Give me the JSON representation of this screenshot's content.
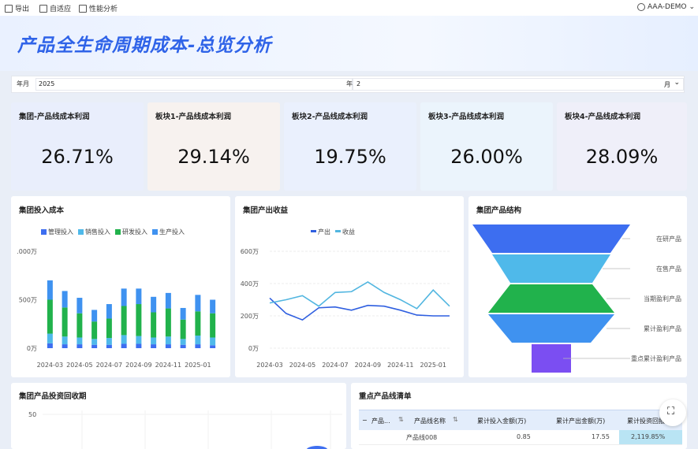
{
  "toolbar": {
    "export_label": "导出",
    "fit_label": "自适应",
    "perf_label": "性能分析",
    "user_label": "AAA-DEMO"
  },
  "title": "产品全生命周期成本-总览分析",
  "filter": {
    "year_label": "年月",
    "year_value": "2025",
    "year_suffix": "年",
    "month_value": "2",
    "month_suffix": "月"
  },
  "kpis": [
    {
      "title": "集团-产品线成本利润",
      "value": "26.71%",
      "bg": "#e9eefc"
    },
    {
      "title": "板块1-产品线成本利润",
      "value": "29.14%",
      "bg": "#f7f2ef"
    },
    {
      "title": "板块2-产品线成本利润",
      "value": "19.75%",
      "bg": "#eaf0fd"
    },
    {
      "title": "板块3-产品线成本利润",
      "value": "26.00%",
      "bg": "#ebf4fc"
    },
    {
      "title": "板块4-产品线成本利润",
      "value": "28.09%",
      "bg": "#efeff9"
    }
  ],
  "colors": {
    "blue": "#3d6ef0",
    "cyan": "#4fb9ea",
    "green": "#21b24c",
    "sky": "#3f92f0",
    "purple": "#7b4ef2",
    "line_blue": "#2f5fe0",
    "line_cyan": "#52b6e0"
  },
  "panel_titles": {
    "invest": "集团投入成本",
    "output": "集团产出收益",
    "structure": "集团产品结构",
    "payback": "集团产品投资回收期",
    "keylist": "重点产品线清单"
  },
  "chart_data": [
    {
      "type": "bar",
      "title": "集团投入成本",
      "stacked": true,
      "categories": [
        "2024-03",
        "2024-04",
        "2024-05",
        "2024-06",
        "2024-07",
        "2024-08",
        "2024-09",
        "2024-10",
        "2024-11",
        "2024-12",
        "2025-01",
        "2025-02"
      ],
      "tick_labels": [
        "2024-03",
        "2024-05",
        "2024-07",
        "2024-09",
        "2024-11",
        "2025-01"
      ],
      "y_ticks": [
        ".000万",
        "500万",
        "0万"
      ],
      "ylim": [
        0,
        1000
      ],
      "series": [
        {
          "name": "管理投入",
          "values": [
            50,
            40,
            40,
            35,
            35,
            45,
            45,
            40,
            40,
            35,
            40,
            30
          ]
        },
        {
          "name": "销售投入",
          "values": [
            100,
            80,
            70,
            60,
            70,
            90,
            80,
            70,
            80,
            60,
            90,
            80
          ]
        },
        {
          "name": "研发投入",
          "values": [
            350,
            300,
            250,
            180,
            200,
            300,
            330,
            260,
            290,
            200,
            250,
            250
          ]
        },
        {
          "name": "生产投入",
          "values": [
            200,
            170,
            160,
            120,
            150,
            180,
            160,
            160,
            160,
            120,
            170,
            140
          ]
        }
      ],
      "legend": "top"
    },
    {
      "type": "line",
      "title": "集团产出收益",
      "x": [
        "2024-03",
        "2024-04",
        "2024-05",
        "2024-06",
        "2024-07",
        "2024-08",
        "2024-09",
        "2024-10",
        "2024-11",
        "2024-12",
        "2025-01",
        "2025-02"
      ],
      "tick_labels": [
        "2024-03",
        "2024-05",
        "2024-07",
        "2024-09",
        "2024-11",
        "2025-01"
      ],
      "y_ticks": [
        "600万",
        "400万",
        "200万",
        "0万"
      ],
      "ylim": [
        0,
        600
      ],
      "series": [
        {
          "name": "产出",
          "values": [
            310,
            215,
            175,
            250,
            255,
            235,
            265,
            260,
            235,
            205,
            200,
            200
          ]
        },
        {
          "name": "收益",
          "values": [
            280,
            300,
            325,
            260,
            345,
            350,
            410,
            345,
            300,
            245,
            360,
            260
          ]
        }
      ],
      "legend": "top"
    },
    {
      "type": "funnel",
      "title": "集团产品结构",
      "stages": [
        "在研产品",
        "在售产品",
        "当期盈利产品",
        "累计盈利产品",
        "重点累计盈利产品"
      ]
    }
  ],
  "payback": {
    "y_tick": "50"
  },
  "table": {
    "headers": [
      "产品...",
      "产品线名称",
      "累计投入金额(万)",
      "累计产出金额(万)",
      "累计投资回报率"
    ],
    "rows": [
      [
        "",
        "产品线008",
        "0.85",
        "17.55",
        "2,119.85%"
      ]
    ]
  }
}
